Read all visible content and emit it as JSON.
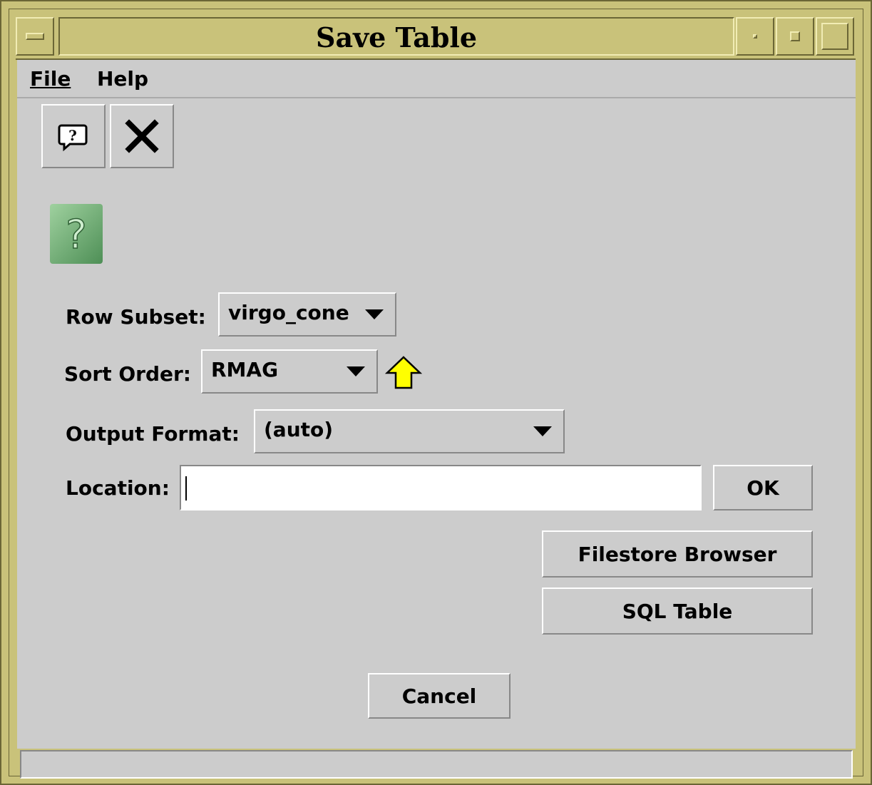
{
  "window": {
    "title": "Save Table"
  },
  "menubar": {
    "file_label": "File",
    "help_label": "Help"
  },
  "toolbar": {
    "help_button": "help-icon",
    "close_button": "close-icon"
  },
  "form": {
    "row_subset": {
      "label": "Row Subset:",
      "value": "virgo_cone"
    },
    "sort_order": {
      "label": "Sort Order:",
      "value": "RMAG",
      "direction_icon": "ascending-arrow-icon"
    },
    "output_format": {
      "label": "Output Format:",
      "value": "(auto)"
    },
    "location": {
      "label": "Location:",
      "value": ""
    }
  },
  "buttons": {
    "ok": "OK",
    "filestore": "Filestore Browser",
    "sql": "SQL Table",
    "cancel": "Cancel"
  },
  "colors": {
    "frame": "#c9c27a",
    "panel": "#cccccc",
    "arrow": "#ffff00"
  }
}
